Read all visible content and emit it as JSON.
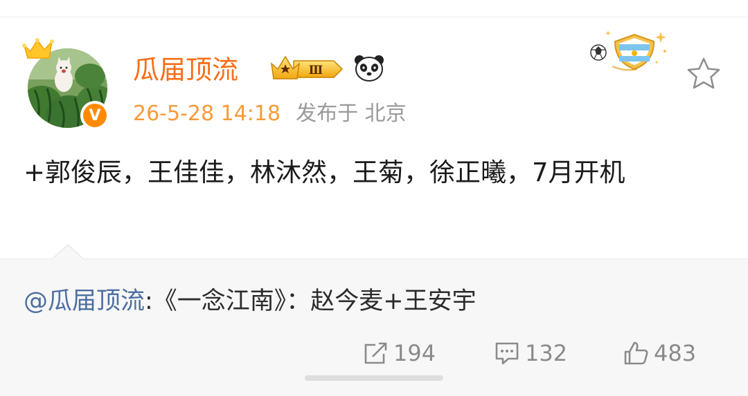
{
  "post": {
    "author": {
      "name": "瓜届顶流",
      "level_badge": "Ⅲ",
      "verified_mark": "V"
    },
    "meta": {
      "time": "26-5-28 14:18",
      "source": "发布于 北京"
    },
    "content": "+郭俊辰，王佳佳，林沐然，王菊，徐正曦，7月开机",
    "quote": {
      "mention": "@瓜届顶流",
      "text": ":《一念江南》：赵今麦+王安宇"
    },
    "actions": {
      "repost_count": "194",
      "comment_count": "132",
      "like_count": "483"
    }
  },
  "icons": {
    "crown": "crown-icon",
    "level": "crown-level-badge-icon",
    "panda": "panda-icon",
    "medal": "argentina-medal-icon",
    "star": "star-icon",
    "repost": "repost-icon",
    "comment": "comment-icon",
    "like": "like-icon"
  },
  "colors": {
    "username": "#f86d15",
    "time": "#f59b3a",
    "mention": "#4d6fa0",
    "quote_bg": "#f7f7f7",
    "muted": "#8a8a8a"
  }
}
